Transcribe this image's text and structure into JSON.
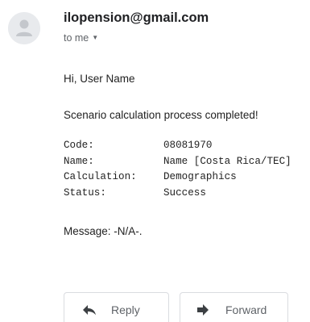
{
  "header": {
    "sender": "ilopension@gmail.com",
    "recipient": "to me",
    "recipient_caret_icon": "caret-down-icon",
    "avatar_icon": "person-avatar-icon"
  },
  "body": {
    "greeting": "Hi, User Name",
    "status_line": "Scenario calculation process completed!",
    "details": [
      {
        "key": "Code:",
        "value": "08081970"
      },
      {
        "key": "Name:",
        "value": "Name [Costa Rica/TEC]"
      },
      {
        "key": "Calculation:",
        "value": "Demographics"
      },
      {
        "key": "Status:",
        "value": "Success"
      }
    ],
    "message": "Message: -N/A-."
  },
  "actions": {
    "reply_label": "Reply",
    "reply_icon": "reply-arrow-icon",
    "forward_label": "Forward",
    "forward_icon": "forward-arrow-icon"
  }
}
